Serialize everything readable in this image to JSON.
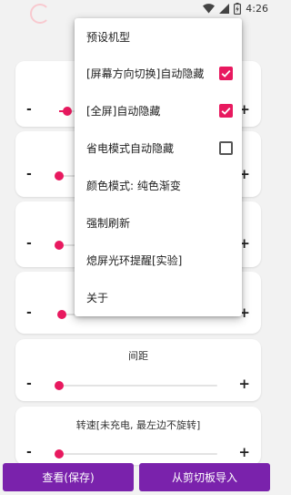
{
  "status_bar": {
    "time": "4:26",
    "icons": [
      "wifi-icon",
      "signal-icon",
      "battery-charging-icon"
    ]
  },
  "colors": {
    "accent": "#e8195f",
    "button_bg": "#7a22ac",
    "background": "#f2f2f2"
  },
  "sliders": {
    "minus_label": "-",
    "plus_label": "+",
    "cards": [
      {
        "title": "",
        "value_fraction": 0.05
      },
      {
        "title": "",
        "value_fraction": 0.0
      },
      {
        "title": "",
        "value_fraction": 0.0
      },
      {
        "title": "",
        "value_fraction": 0.02
      },
      {
        "title": "间距",
        "value_fraction": 0.0
      },
      {
        "title": "转速[未充电, 最左边不旋转]",
        "value_fraction": 0.0
      }
    ]
  },
  "menu": {
    "items": [
      {
        "label": "预设机型"
      },
      {
        "label": "[屏幕方向切换]自动隐藏",
        "checked": true
      },
      {
        "label": "[全屏]自动隐藏",
        "checked": true
      },
      {
        "label": "省电模式自动隐藏",
        "checked": false
      },
      {
        "label": "颜色模式: 纯色渐变"
      },
      {
        "label": "强制刷新"
      },
      {
        "label": "熄屏光环提醒[实验]"
      },
      {
        "label": "关于"
      }
    ]
  },
  "buttons": {
    "view_save": "查看(保存)",
    "import_clipboard": "从剪切板导入"
  }
}
